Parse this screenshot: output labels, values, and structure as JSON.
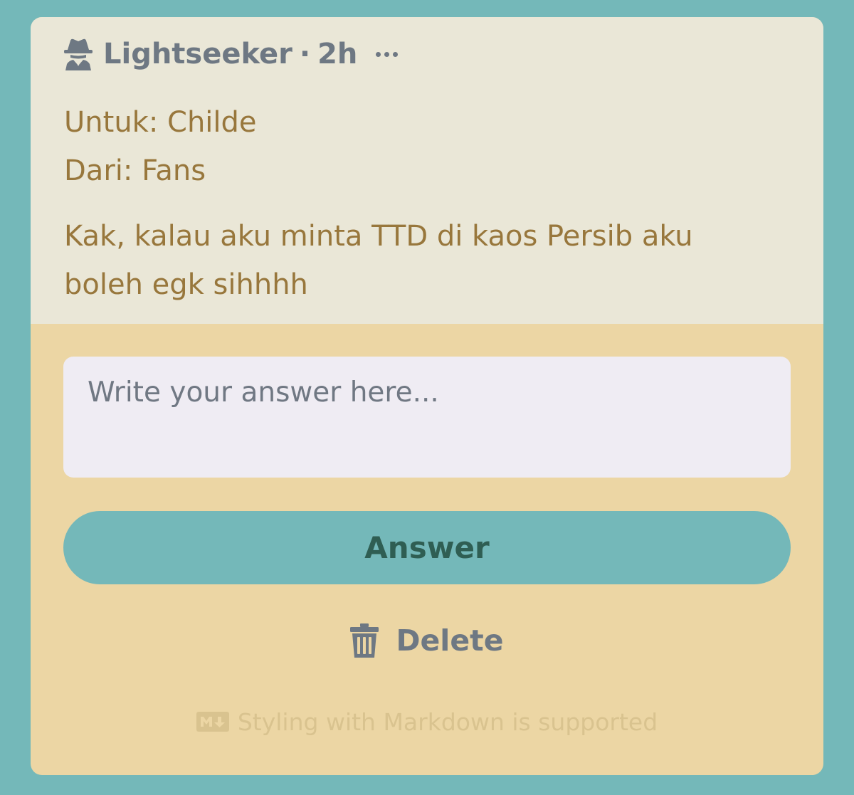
{
  "question": {
    "author": "Lightseeker",
    "separator": "·",
    "time": "2h",
    "author_icon": "incognito-spy-icon",
    "more_icon": "ellipsis-icon",
    "line_to": "Untuk: Childe",
    "line_from": "Dari: Fans",
    "body_line1": "Kak, kalau aku minta TTD di kaos Persib aku",
    "body_line2": "boleh egk sihhhh"
  },
  "answer_form": {
    "placeholder": "Write your answer here...",
    "answer_label": "Answer",
    "delete_label": "Delete",
    "delete_icon": "trash-icon",
    "markdown_hint": "Styling with Markdown is supported",
    "markdown_icon": "markdown-icon"
  },
  "colors": {
    "page_background": "#74b8b9",
    "question_background": "#eae7d7",
    "form_background": "#ecd6a4",
    "question_text": "#98773c",
    "meta_text": "#6e7883",
    "answer_button": "#74b8b9",
    "answer_button_text": "#2f5e53"
  }
}
